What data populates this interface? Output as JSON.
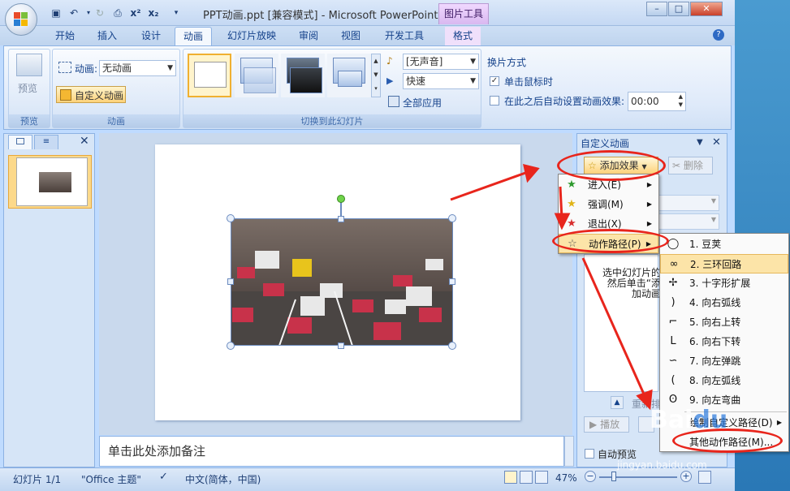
{
  "window": {
    "title": "PPT动画.ppt [兼容模式] - Microsoft PowerPoint",
    "context_tab_title": "图片工具",
    "controls": [
      "–",
      "□",
      "✕"
    ]
  },
  "qat": {
    "dropdown": "▾"
  },
  "tabs": [
    "开始",
    "插入",
    "设计",
    "动画",
    "幻灯片放映",
    "审阅",
    "视图",
    "开发工具",
    "格式"
  ],
  "active_tab": "动画",
  "ribbon": {
    "preview": {
      "button_label": "预览",
      "group_label": "预览"
    },
    "animation": {
      "anim_label": "动画:",
      "anim_value": "无动画",
      "custom_anim_label": "自定义动画",
      "group_label": "动画"
    },
    "transitions": {
      "sound_value": "[无声音]",
      "speed_value": "快速",
      "apply_all_label": "全部应用",
      "group_label": "切换到此幻灯片"
    },
    "advance": {
      "heading": "换片方式",
      "on_click_label": "单击鼠标时",
      "auto_label": "在此之后自动设置动画效果:",
      "auto_time": "00:00"
    }
  },
  "left_pane": {
    "slide_number": "1"
  },
  "notes": {
    "placeholder": "单击此处添加备注"
  },
  "task_pane": {
    "title": "自定义动画",
    "add_effect_label": "添加效果",
    "delete_label": "删除",
    "hint_lines": [
      "选中幻灯片的",
      "然后单击“添",
      "加动画"
    ],
    "reorder_label": "重新排",
    "play_label": "播放",
    "autopreview_label": "自动预览"
  },
  "add_effect_menu": [
    {
      "label": "进入(E)",
      "icon": "star-green-icon"
    },
    {
      "label": "强调(M)",
      "icon": "star-yellow-icon"
    },
    {
      "label": "退出(X)",
      "icon": "star-red-icon"
    },
    {
      "label": "动作路径(P)",
      "icon": "star-outline-icon"
    }
  ],
  "path_submenu": [
    {
      "label": "1. 豆荚",
      "glyph": "◯"
    },
    {
      "label": "2. 三环回路",
      "glyph": "∞"
    },
    {
      "label": "3. 十字形扩展",
      "glyph": "✢"
    },
    {
      "label": "4. 向右弧线",
      "glyph": ")"
    },
    {
      "label": "5. 向右上转",
      "glyph": "⌐"
    },
    {
      "label": "6. 向右下转",
      "glyph": "L"
    },
    {
      "label": "7. 向左弹跳",
      "glyph": "∽"
    },
    {
      "label": "8. 向左弧线",
      "glyph": "("
    },
    {
      "label": "9. 向左弯曲",
      "glyph": "ʘ"
    },
    {
      "label": "绘制自定义路径(D)",
      "glyph": ""
    },
    {
      "label": "其他动作路径(M)...",
      "glyph": ""
    }
  ],
  "statusbar": {
    "slide_info": "幻灯片 1/1",
    "theme": "\"Office 主题\"",
    "language": "中文(简体，中国)",
    "zoom": "47%"
  },
  "colors": {
    "annotation_red": "#e8251c",
    "ribbon_blue": "#15428b",
    "highlight": "#fce4a8"
  }
}
